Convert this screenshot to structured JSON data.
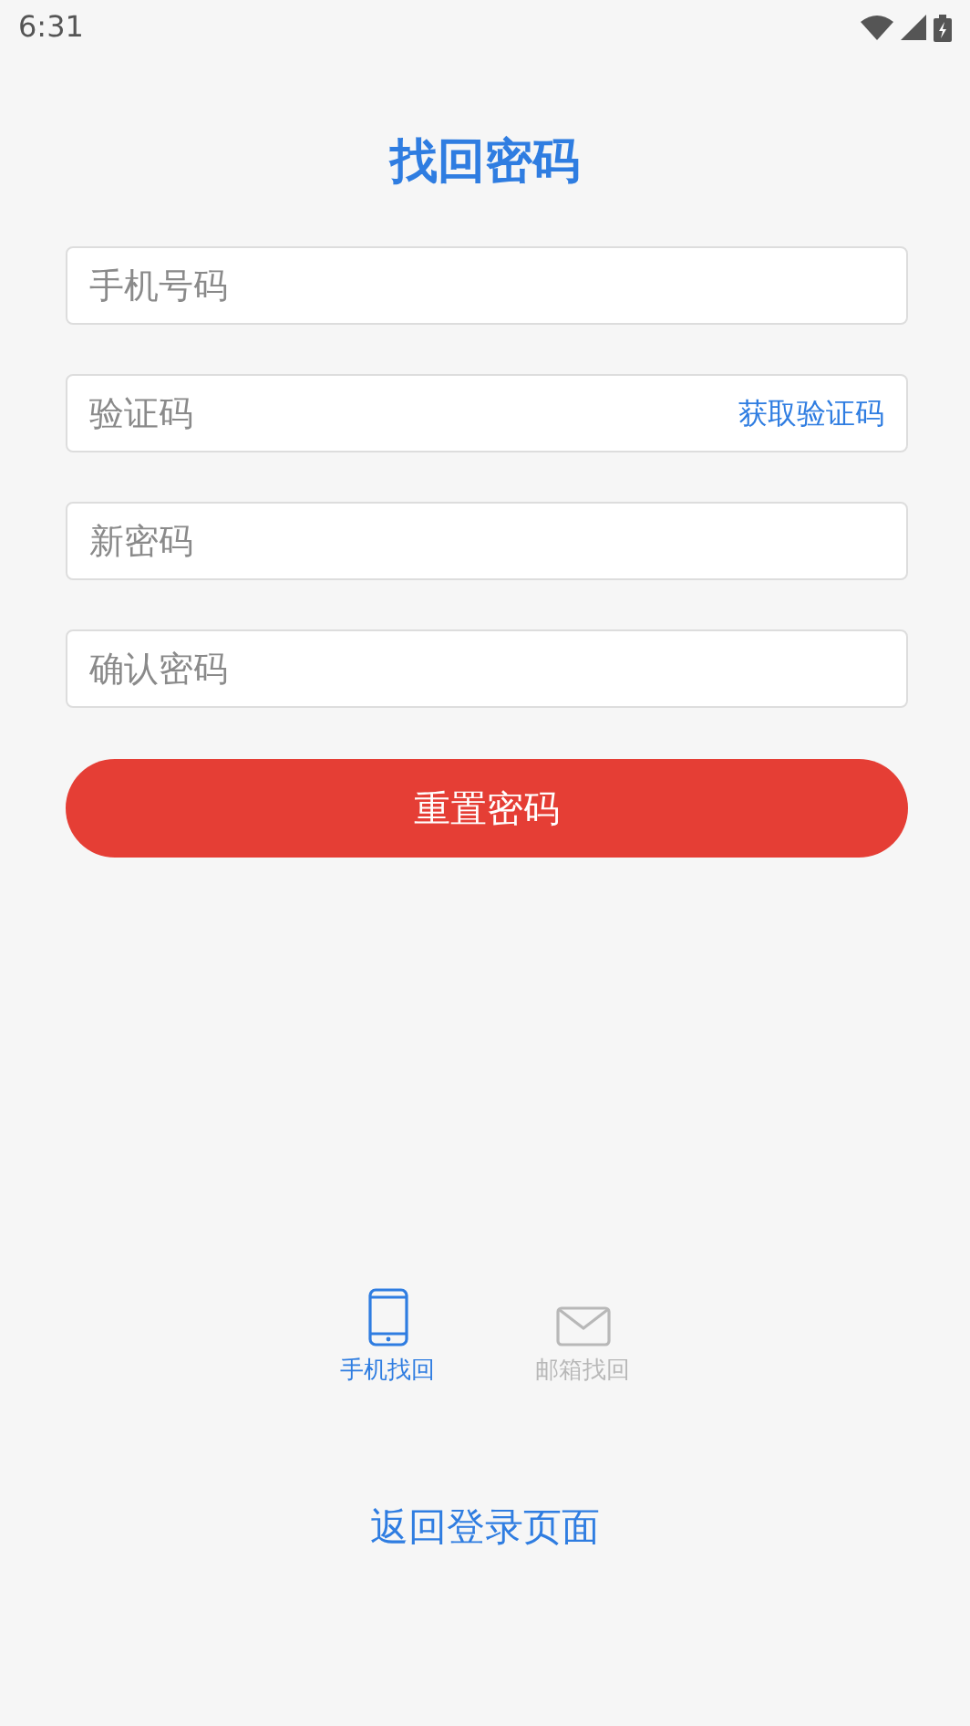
{
  "status_bar": {
    "time": "6:31"
  },
  "title": "找回密码",
  "fields": [
    {
      "placeholder": "手机号码"
    },
    {
      "placeholder": "验证码",
      "action": "获取验证码"
    },
    {
      "placeholder": "新密码"
    },
    {
      "placeholder": "确认密码"
    }
  ],
  "submit": "重置密码",
  "tabs": [
    {
      "kind": "phone",
      "label": "手机找回",
      "selected": true
    },
    {
      "kind": "email",
      "label": "邮箱找回",
      "selected": false
    }
  ],
  "back_link": "返回登录页面"
}
